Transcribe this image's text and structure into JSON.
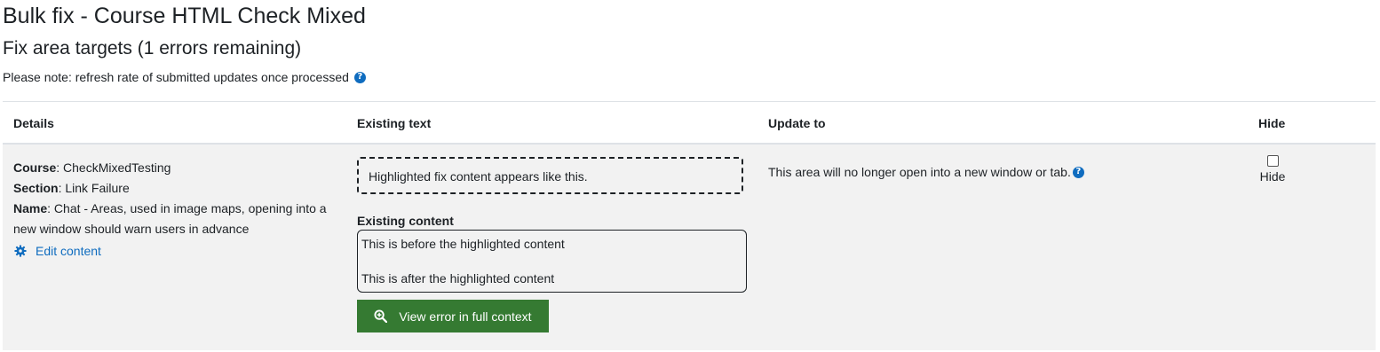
{
  "page": {
    "title": "Bulk fix - Course HTML Check Mixed",
    "subtitle": "Fix area targets (1 errors remaining)",
    "note": "Please note: refresh rate of submitted updates once processed",
    "note_icon": "help-icon"
  },
  "table": {
    "headers": {
      "details": "Details",
      "existing": "Existing text",
      "update": "Update to",
      "hide": "Hide"
    },
    "rows": [
      {
        "details": {
          "course_label": "Course",
          "course_value": "CheckMixedTesting",
          "section_label": "Section",
          "section_value": "Link Failure",
          "name_label": "Name",
          "name_value": "Chat - Areas, used in image maps, opening into a new window should warn users in advance",
          "edit_link": "Edit content",
          "edit_icon": "gear-icon"
        },
        "existing": {
          "highlight_text": "Highlighted fix content appears like this.",
          "content_label": "Existing content",
          "content_before": "This is before the highlighted content",
          "content_after": "This is after the highlighted content",
          "view_button": "View error in full context",
          "view_icon": "zoom-in-icon"
        },
        "update": {
          "text": "This area will no longer open into a new window or tab.",
          "icon": "help-icon"
        },
        "hide": {
          "label": "Hide",
          "checked": false
        }
      }
    ]
  },
  "colors": {
    "link": "#0f6cbf",
    "button": "#357a32",
    "row_bg": "#f2f2f2"
  }
}
